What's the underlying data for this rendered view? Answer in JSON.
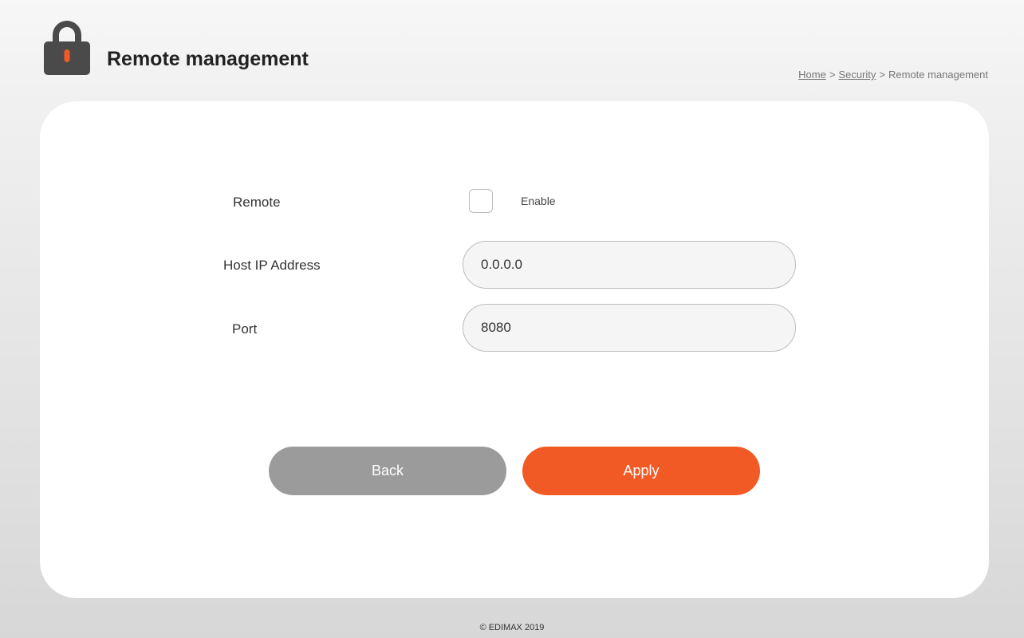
{
  "header": {
    "title": "Remote management",
    "icon": "lock-icon"
  },
  "breadcrumb": {
    "items": [
      "Home",
      "Security",
      "Remote management"
    ],
    "separator": ">"
  },
  "form": {
    "remote": {
      "label": "Remote",
      "checkbox_label": "Enable",
      "checked": false
    },
    "host_ip": {
      "label": "Host IP Address",
      "value": "0.0.0.0"
    },
    "port": {
      "label": "Port",
      "value": "8080"
    }
  },
  "buttons": {
    "back_label": "Back",
    "apply_label": "Apply"
  },
  "footer": {
    "copyright": "© EDIMAX 2019"
  },
  "colors": {
    "accent": "#f15a24",
    "back_button": "#9b9b9b",
    "icon": "#4a4a4a"
  }
}
